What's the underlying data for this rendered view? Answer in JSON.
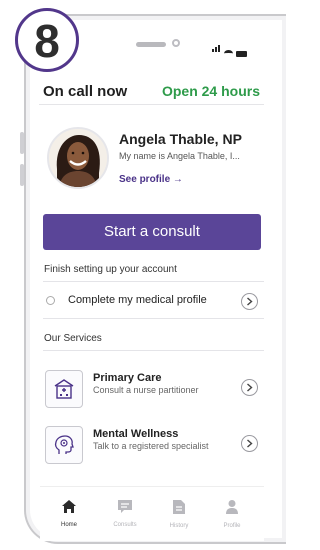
{
  "badge": {
    "number": "8"
  },
  "header": {
    "on_call": "On call now",
    "open": "Open 24 hours"
  },
  "provider": {
    "name": "Angela Thable, NP",
    "intro": "My name is Angela Thable, I...",
    "see_profile": "See profile",
    "arrow": "→"
  },
  "consult_button": "Start a consult",
  "account": {
    "title": "Finish setting up your account",
    "task": "Complete my medical profile",
    "task_done": false
  },
  "services": {
    "title": "Our Services",
    "items": [
      {
        "title": "Primary Care",
        "subtitle": "Consult a nurse partitioner",
        "icon": "clinic-building-icon"
      },
      {
        "title": "Mental Wellness",
        "subtitle": "Talk to a registered specialist",
        "icon": "head-gear-icon"
      }
    ]
  },
  "nav": {
    "items": [
      {
        "label": "Home",
        "icon": "home-icon",
        "active": true
      },
      {
        "label": "Consults",
        "icon": "chat-icon",
        "active": false
      },
      {
        "label": "History",
        "icon": "document-icon",
        "active": false
      },
      {
        "label": "Profile",
        "icon": "person-icon",
        "active": false
      }
    ]
  },
  "colors": {
    "brand": "#5a4598",
    "open_green": "#2e9b4a",
    "link": "#4a3288"
  }
}
